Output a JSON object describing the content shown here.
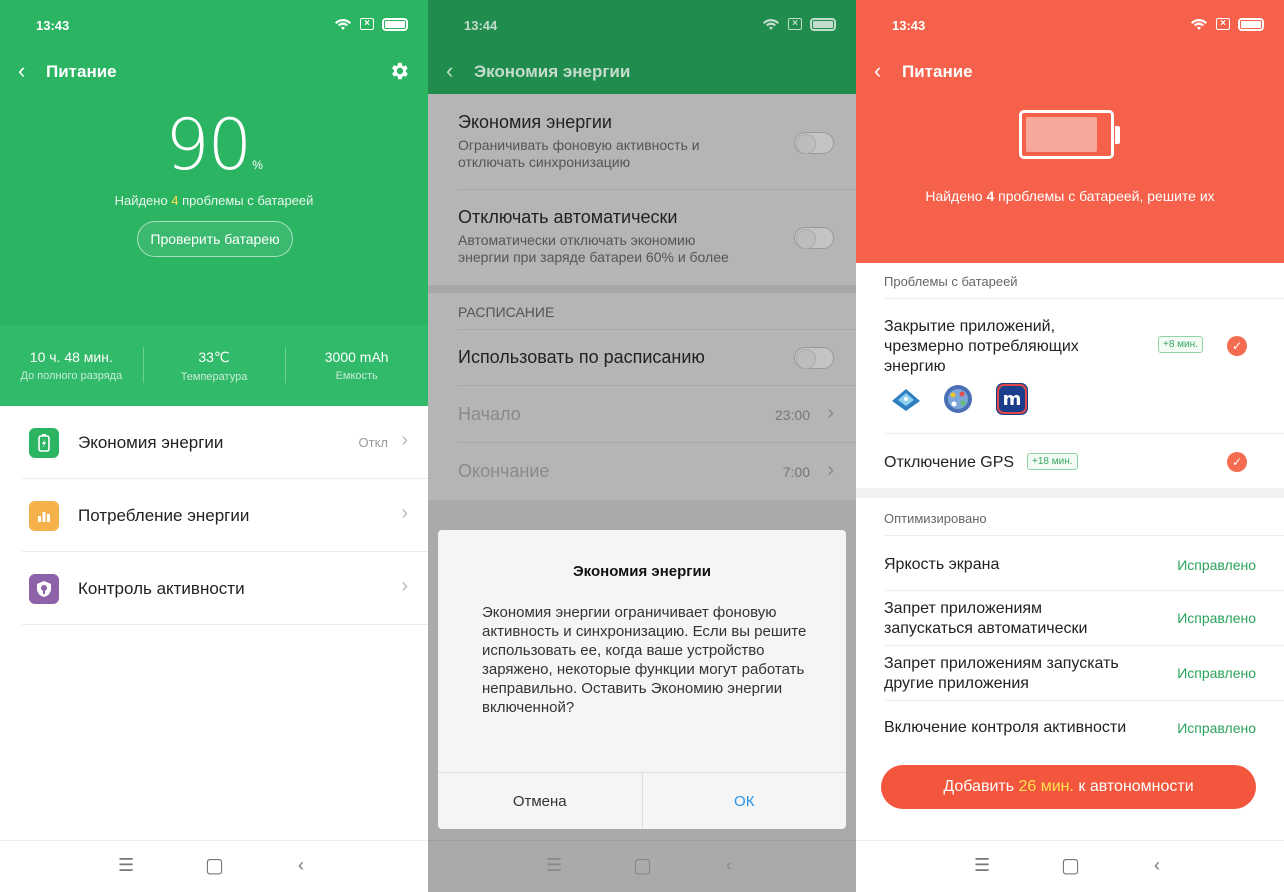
{
  "screen1": {
    "status": {
      "time": "13:43"
    },
    "header": {
      "back": "‹",
      "title": "Питание"
    },
    "battery": {
      "percent": "90",
      "unit": "%"
    },
    "found": {
      "prefix": "Найдено ",
      "count": "4",
      "suffix": " проблемы с батареей"
    },
    "check_button": "Проверить батарею",
    "stats": [
      {
        "value": "10 ч. 48 мин.",
        "label": "До полного разряда"
      },
      {
        "value": "33℃",
        "label": "Температура"
      },
      {
        "value": "3000 mAh",
        "label": "Емкость"
      }
    ],
    "menu": [
      {
        "label": "Экономия энергии",
        "value": "Откл",
        "icon": "battery-saver-icon",
        "color": "#2bb563"
      },
      {
        "label": "Потребление энергии",
        "value": "",
        "icon": "bar-chart-icon",
        "color": "#f5b24a"
      },
      {
        "label": "Контроль активности",
        "value": "",
        "icon": "shield-bulb-icon",
        "color": "#8d62a8"
      }
    ]
  },
  "screen2": {
    "status": {
      "time": "13:44"
    },
    "header": {
      "back": "‹",
      "title": "Экономия энергии"
    },
    "rows": [
      {
        "title": "Экономия энергии",
        "desc1": "Ограничивать фоновую активность и",
        "desc2": "отключать синхронизацию"
      },
      {
        "title": "Отключать автоматически",
        "desc1": "Автоматически отключать экономию",
        "desc2": "энергии при заряде батареи 60% и более"
      }
    ],
    "section": "РАСПИСАНИЕ",
    "schedule": {
      "label": "Использовать по расписанию"
    },
    "start": {
      "label": "Начало",
      "value": "23:00"
    },
    "end": {
      "label": "Окончание",
      "value": "7:00"
    },
    "dialog": {
      "title": "Экономия энергии",
      "body": "Экономия энергии ограничивает фоновую активность и синхронизацию. Если вы решите использовать ее, когда ваше устройство заряжено, некоторые функции могут работать неправильно. Оставить Экономию энергии включенной?",
      "cancel": "Отмена",
      "ok": "ОК"
    }
  },
  "screen3": {
    "status": {
      "time": "13:43"
    },
    "header": {
      "back": "‹",
      "title": "Питание"
    },
    "found": {
      "prefix": "Найдено ",
      "count": "4",
      "suffix": " проблемы с батареей, решите их"
    },
    "problems_head": "Проблемы с батареей",
    "problem1": {
      "line1": "Закрытие приложений,",
      "line2": "чрезмерно потребляющих",
      "line3": "энергию",
      "badge": "+8 мин."
    },
    "problem2": {
      "label": "Отключение GPS",
      "badge": "+18 мин."
    },
    "optimized_head": "Оптимизировано",
    "fixed": [
      {
        "line1": "Яркость экрана",
        "line2": "",
        "status": "Исправлено"
      },
      {
        "line1": "Запрет приложениям",
        "line2": "запускаться автоматически",
        "status": "Исправлено"
      },
      {
        "line1": "Запрет приложениям запускать",
        "line2": "другие приложения",
        "status": "Исправлено"
      },
      {
        "line1": "Включение контроля активности",
        "line2": "",
        "status": "Исправлено"
      }
    ],
    "cta": {
      "prefix": "Добавить ",
      "highlight": "26 мин.",
      "suffix": " к автономности"
    }
  },
  "navbar": {
    "menu": "☰",
    "home": "▢",
    "back": "‹"
  },
  "colors": {
    "green": "#2bb563",
    "orange": "#f5614a",
    "ok_blue": "#2a93e6",
    "fixed_green": "#2aa35a"
  }
}
